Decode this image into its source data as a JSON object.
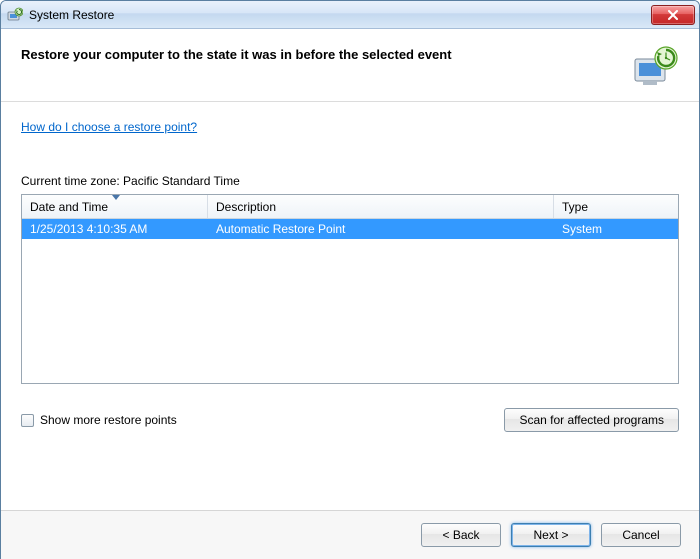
{
  "window": {
    "title": "System Restore"
  },
  "header": {
    "heading": "Restore your computer to the state it was in before the selected event"
  },
  "help": {
    "link_text": "How do I choose a restore point?"
  },
  "timezone": {
    "label": "Current time zone: Pacific Standard Time"
  },
  "table": {
    "columns": {
      "date": "Date and Time",
      "desc": "Description",
      "type": "Type"
    },
    "rows": [
      {
        "date": "1/25/2013 4:10:35 AM",
        "desc": "Automatic Restore Point",
        "type": "System"
      }
    ]
  },
  "options": {
    "show_more_label": "Show more restore points",
    "scan_button": "Scan for affected programs"
  },
  "footer": {
    "back": "< Back",
    "next": "Next >",
    "cancel": "Cancel"
  }
}
